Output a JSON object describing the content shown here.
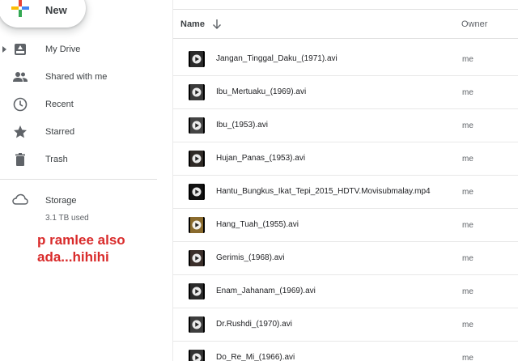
{
  "sidebar": {
    "new_label": "New",
    "items": [
      {
        "label": "My Drive",
        "icon": "drive-icon"
      },
      {
        "label": "Shared with me",
        "icon": "people-icon"
      },
      {
        "label": "Recent",
        "icon": "clock-icon"
      },
      {
        "label": "Starred",
        "icon": "star-icon"
      },
      {
        "label": "Trash",
        "icon": "trash-icon"
      }
    ],
    "storage": {
      "label": "Storage",
      "used": "3.1 TB used",
      "icon": "cloud-icon"
    },
    "overlay_text": "p ramlee also ada...hihihi"
  },
  "list": {
    "header": {
      "name": "Name",
      "owner": "Owner",
      "sort_icon": "arrow-down-icon"
    },
    "files": [
      {
        "name": "Jangan_Tinggal_Daku_(1971).avi",
        "owner": "me",
        "thumb_color": "#2b2b2b"
      },
      {
        "name": "Ibu_Mertuaku_(1969).avi",
        "owner": "me",
        "thumb_color": "#3a3a3a"
      },
      {
        "name": "Ibu_(1953).avi",
        "owner": "me",
        "thumb_color": "#444444"
      },
      {
        "name": "Hujan_Panas_(1953).avi",
        "owner": "me",
        "thumb_color": "#2f2a26"
      },
      {
        "name": "Hantu_Bungkus_Ikat_Tepi_2015_HDTV.Movisubmalay.mp4",
        "owner": "me",
        "thumb_color": "#111111"
      },
      {
        "name": "Hang_Tuah_(1955).avi",
        "owner": "me",
        "thumb_color": "#8a6b2e"
      },
      {
        "name": "Gerimis_(1968).avi",
        "owner": "me",
        "thumb_color": "#3b2f2a"
      },
      {
        "name": "Enam_Jahanam_(1969).avi",
        "owner": "me",
        "thumb_color": "#2a2a2a"
      },
      {
        "name": "Dr.Rushdi_(1970).avi",
        "owner": "me",
        "thumb_color": "#3d3d3d"
      },
      {
        "name": "Do_Re_Mi_(1966).avi",
        "owner": "me",
        "thumb_color": "#333333"
      }
    ]
  }
}
